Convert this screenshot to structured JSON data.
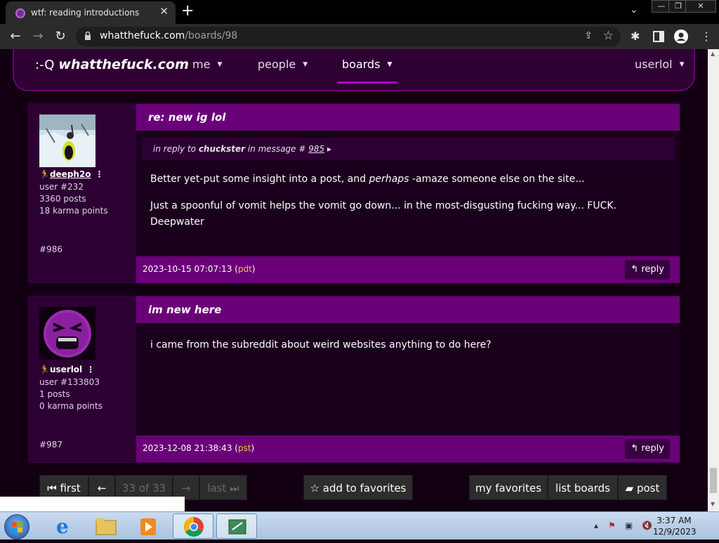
{
  "browser": {
    "tab_title": "wtf: reading introductions",
    "tab_close": "✕",
    "new_tab": "+",
    "url_host": "whatthefuck.com",
    "url_path": "/boards/98",
    "window_buttons": [
      "—",
      "❐",
      "✕"
    ]
  },
  "site": {
    "logo_face": ":-Q",
    "logo_name": "whatthefuck.com",
    "nav": [
      {
        "label": "me"
      },
      {
        "label": "people"
      },
      {
        "label": "boards"
      }
    ],
    "user_menu": "userlol"
  },
  "posts": [
    {
      "username": "deeph2o",
      "user_id": "user #232",
      "posts": "3360 posts",
      "karma": "18 karma points",
      "msg_num": "#986",
      "subject": "re: new ig lol",
      "reply_prefix": "in reply to ",
      "reply_user": "chuckster",
      "reply_mid": " in message # ",
      "reply_ref": "985",
      "paragraphs": [
        {
          "before": "Better yet-put some insight into a post, and ",
          "em": "perhaps",
          "after": " -amaze someone else on the site..."
        },
        {
          "before": "Just a spoonful of vomit helps the vomit go down... in the most-disgusting fucking way... FUCK. Deepwater",
          "em": "",
          "after": ""
        }
      ],
      "timestamp": "2023-10-15 07:07:13 (",
      "tz": "pdt",
      "ts_close": ")",
      "reply_label": "reply"
    },
    {
      "username": "userlol",
      "user_id": "user #133803",
      "posts": "1 posts",
      "karma": "0 karma points",
      "msg_num": "#987",
      "subject": "im new here",
      "paragraphs": [
        {
          "before": "i came from the subreddit about weird websites anything to do here?",
          "em": "",
          "after": ""
        }
      ],
      "timestamp": "2023-12-08 21:38:43 (",
      "tz": "pst",
      "ts_close": ")",
      "reply_label": "reply"
    }
  ],
  "pager": {
    "first": "first",
    "page": "33 of 33",
    "last": "last",
    "add_favorites": "add to favorites",
    "my_favorites": "my favorites",
    "list_boards": "list boards",
    "post": "post"
  },
  "taskbar": {
    "time": "3:37 AM",
    "date": "12/9/2023"
  },
  "colors": {
    "accent": "#6a0078",
    "panel": "#2c0033",
    "body": "#1a001d",
    "tz": "#f2c240"
  }
}
